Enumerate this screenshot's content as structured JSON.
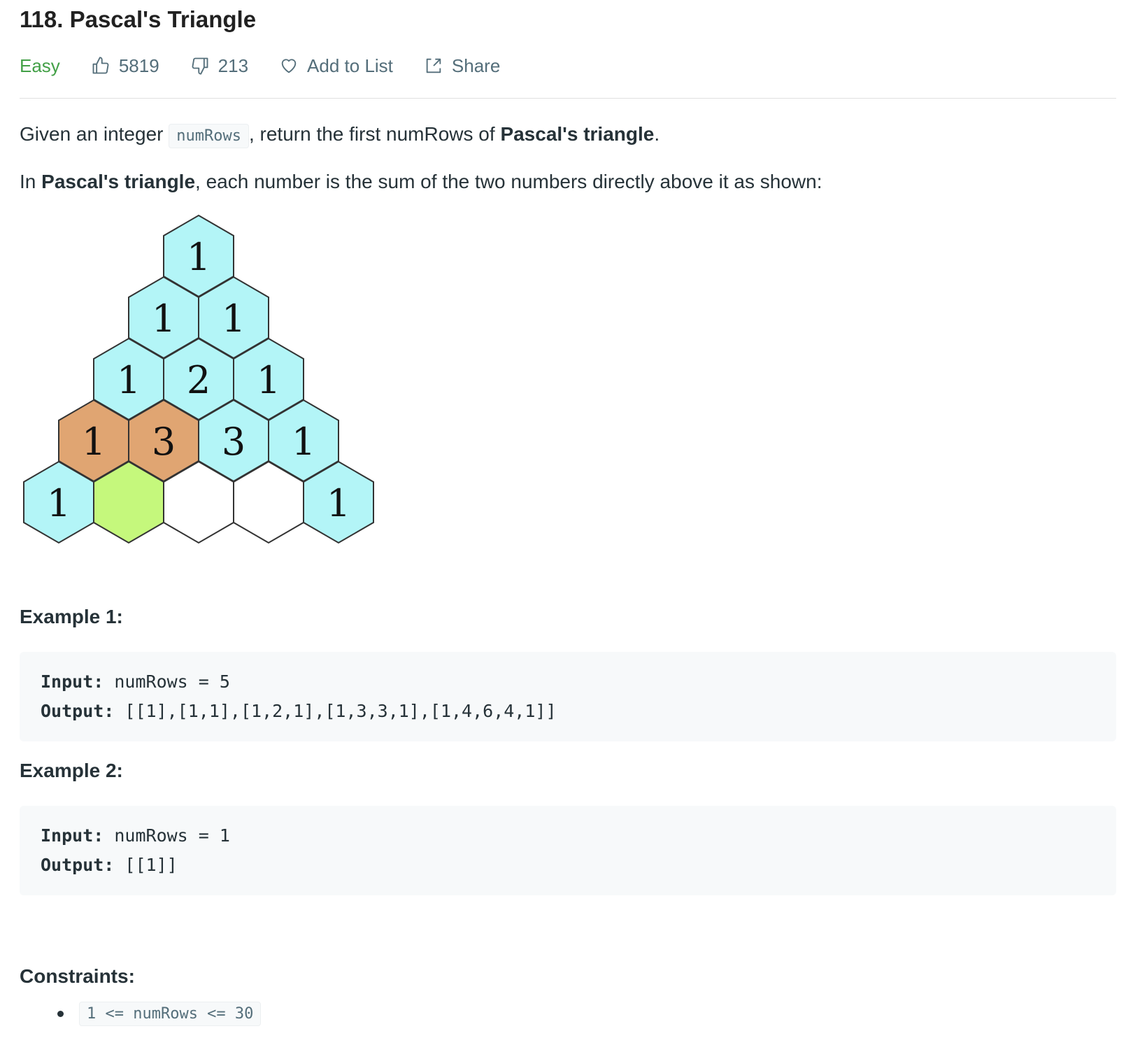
{
  "problem": {
    "title": "118. Pascal's Triangle",
    "difficulty": "Easy",
    "likes": "5819",
    "dislikes": "213",
    "add_to_list": "Add to List",
    "share": "Share"
  },
  "description": {
    "p1_prefix": "Given an integer ",
    "p1_code": "numRows",
    "p1_middle": ", return the first numRows of ",
    "p1_bold": "Pascal's triangle",
    "p1_suffix": ".",
    "p2_prefix": "In ",
    "p2_bold": "Pascal's triangle",
    "p2_suffix": ", each number is the sum of the two numbers directly above it as shown:"
  },
  "figure": {
    "rows": [
      [
        {
          "v": "1",
          "c": "#b3f5f7"
        }
      ],
      [
        {
          "v": "1",
          "c": "#b3f5f7"
        },
        {
          "v": "1",
          "c": "#b3f5f7"
        }
      ],
      [
        {
          "v": "1",
          "c": "#b3f5f7"
        },
        {
          "v": "2",
          "c": "#b3f5f7"
        },
        {
          "v": "1",
          "c": "#b3f5f7"
        }
      ],
      [
        {
          "v": "1",
          "c": "#e0a572"
        },
        {
          "v": "3",
          "c": "#e0a572"
        },
        {
          "v": "3",
          "c": "#b3f5f7"
        },
        {
          "v": "1",
          "c": "#b3f5f7"
        }
      ],
      [
        {
          "v": "1",
          "c": "#b3f5f7"
        },
        {
          "v": "",
          "c": "#c5f87c"
        },
        {
          "v": "",
          "c": "#ffffff"
        },
        {
          "v": "",
          "c": "#ffffff"
        },
        {
          "v": "1",
          "c": "#b3f5f7"
        }
      ]
    ]
  },
  "examples": [
    {
      "heading": "Example 1:",
      "input_label": "Input:",
      "input_value": " numRows = 5",
      "output_label": "Output:",
      "output_value": " [[1],[1,1],[1,2,1],[1,3,3,1],[1,4,6,4,1]]"
    },
    {
      "heading": "Example 2:",
      "input_label": "Input:",
      "input_value": " numRows = 1",
      "output_label": "Output:",
      "output_value": " [[1]]"
    }
  ],
  "constraints": {
    "heading": "Constraints:",
    "items": [
      "1 <= numRows <= 30"
    ]
  },
  "colors": {
    "easy": "#43a047",
    "code_bg": "#f7f9fa",
    "text": "#263238"
  }
}
